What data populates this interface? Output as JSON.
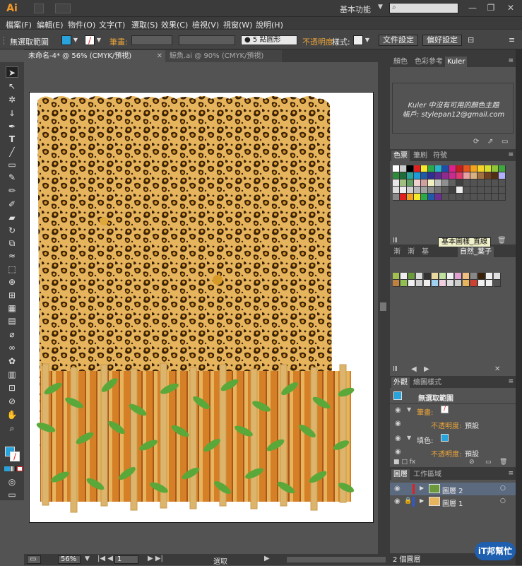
{
  "app": {
    "logo": "Ai",
    "workspace": "基本功能",
    "window_controls": [
      "—",
      "❐",
      "✕"
    ]
  },
  "menu": [
    "檔案(F)",
    "編輯(E)",
    "物件(O)",
    "文字(T)",
    "選取(S)",
    "效果(C)",
    "檢視(V)",
    "視窗(W)",
    "說明(H)"
  ],
  "control_bar": {
    "selection_label": "無選取範圍",
    "stroke_label": "筆畫:",
    "brush_label": "5 點圓形",
    "opacity_label": "不透明度",
    "style_label": "樣式:",
    "doc_setup": "文件設定",
    "prefs": "偏好設定"
  },
  "tabs": [
    {
      "label": "未命名-4* @ 56% (CMYK/預視)",
      "active": true
    },
    {
      "label": "鯨魚.ai @ 90% (CMYK/預視)",
      "active": false
    }
  ],
  "status": {
    "zoom": "56%",
    "page": "1",
    "mode": "選取"
  },
  "kuler": {
    "tabs": [
      "顏色",
      "色彩參考",
      "Kuler"
    ],
    "message": "Kuler 中沒有可用的顏色主題",
    "account": "帳戶: stylepan12@gmail.com"
  },
  "swatches": {
    "tabs": [
      "色票",
      "筆刷",
      "符號"
    ],
    "tooltip": "基本圖樣_直線"
  },
  "patterns": {
    "tabs": [
      "漸",
      "漸",
      "基",
      "自然_葉子"
    ]
  },
  "appearance": {
    "tabs": [
      "外觀",
      "繪圖樣式"
    ],
    "title": "無選取範圍",
    "rows": [
      {
        "label": "筆畫:",
        "value": ""
      },
      {
        "label": "不透明度:",
        "value": "預設"
      },
      {
        "label": "填色:",
        "value": ""
      },
      {
        "label": "不透明度:",
        "value": "預設"
      }
    ]
  },
  "layers": {
    "tabs": [
      "圖層",
      "工作區域"
    ],
    "items": [
      "圖層 2",
      "圖層 1"
    ],
    "count": "2 個圖層"
  },
  "colors": {
    "accent_orange": "#e8a33a",
    "panel_bg": "#535353",
    "leopard_base": "#e9b85a",
    "leopard_spot": "#3a2208",
    "bamboo": "#d9b46a",
    "leaf": "#5aa83a",
    "fence": "#d7812a"
  },
  "watermark": "iT邦幫忙"
}
